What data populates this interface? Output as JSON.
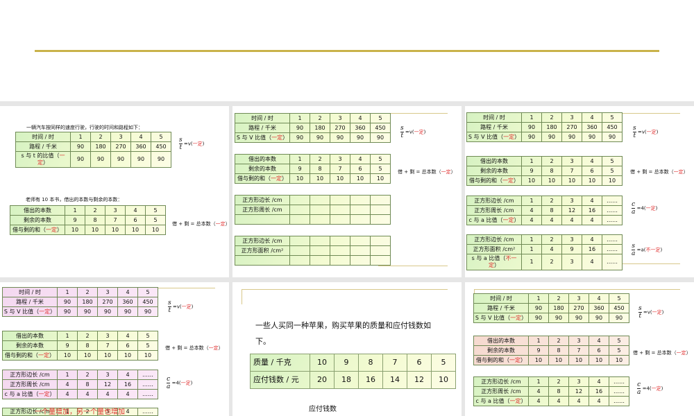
{
  "tables": {
    "car": [
      [
        "时间 / 时",
        "1",
        "2",
        "3",
        "4",
        "5"
      ],
      [
        "路程 / 千米",
        "90",
        "180",
        "270",
        "360",
        "450"
      ],
      [
        "s 与 t 的比值（一定）",
        "90",
        "90",
        "90",
        "90",
        "90"
      ]
    ],
    "carV": [
      [
        "时间 / 时",
        "1",
        "2",
        "3",
        "4",
        "5"
      ],
      [
        "路程 / 千米",
        "90",
        "180",
        "270",
        "360",
        "450"
      ],
      [
        "S 与 V 比值（一定）",
        "90",
        "90",
        "90",
        "90",
        "90"
      ]
    ],
    "books": [
      [
        "借出的本数",
        "1",
        "2",
        "3",
        "4",
        "5"
      ],
      [
        "剩余的本数",
        "9",
        "8",
        "7",
        "6",
        "5"
      ],
      [
        "借与剩的和（一定）",
        "10",
        "10",
        "10",
        "10",
        "10"
      ]
    ],
    "sqPerimEmpty": [
      [
        "正方形边长 /cm",
        "",
        "",
        "",
        "",
        ""
      ],
      [
        "正方形周长 /cm",
        "",
        "",
        "",
        "",
        ""
      ],
      [
        "",
        "",
        "",
        "",
        "",
        ""
      ]
    ],
    "sqAreaEmpty": [
      [
        "正方形边长 /cm",
        "",
        "",
        "",
        "",
        ""
      ],
      [
        "正方形面积 /cm²",
        "",
        "",
        "",
        "",
        ""
      ],
      [
        "",
        "",
        "",
        "",
        "",
        ""
      ]
    ],
    "sqPerim": [
      [
        "正方形边长 /cm",
        "1",
        "2",
        "3",
        "4",
        "……"
      ],
      [
        "正方形周长 /cm",
        "4",
        "8",
        "12",
        "16",
        "……"
      ],
      [
        "c 与 a 比值（一定）",
        "4",
        "4",
        "4",
        "4",
        "……"
      ]
    ],
    "sqArea": [
      [
        "正方形边长 /cm",
        "1",
        "2",
        "3",
        "4",
        "……"
      ],
      [
        "正方形面积 /cm²",
        "1",
        "4",
        "9",
        "16",
        "……"
      ],
      [
        "s 与 a 比值（不一定）",
        "1",
        "2",
        "3",
        "4",
        "……"
      ]
    ],
    "apple": [
      [
        "质量 / 千克",
        "10",
        "9",
        "8",
        "7",
        "6",
        "5"
      ],
      [
        "应付钱数 / 元",
        "20",
        "18",
        "16",
        "14",
        "12",
        "10"
      ]
    ]
  },
  "slide1": {
    "caption_car": "一辆汽车按同样的速度行驶，行驶的时间和路程如下：",
    "caption_books": "老师有 10 本书，借出的本数与剩余的本数："
  },
  "formulas": {
    "st": {
      "num": "s",
      "den": "t",
      "rhs": "=v(",
      "red": "一定",
      "close": ")"
    },
    "books": {
      "rhs": "借 + 剩 = 总本数（",
      "red": "一定",
      "close": "）"
    },
    "ca": {
      "num": "c",
      "den": "a",
      "rhs": "=4(",
      "red": "一定",
      "close": ")"
    },
    "sa": {
      "num": "s",
      "den": "a",
      "rhs": "=a(",
      "red": "不一定",
      "close": ")"
    }
  },
  "slide4": {
    "red_text": "一个量增加，另一个量也增加"
  },
  "slide5": {
    "line1": "一些人买同一种苹果，购买苹果的质量和应付钱数如",
    "line2": "下。",
    "bottom": "应付钱数"
  }
}
